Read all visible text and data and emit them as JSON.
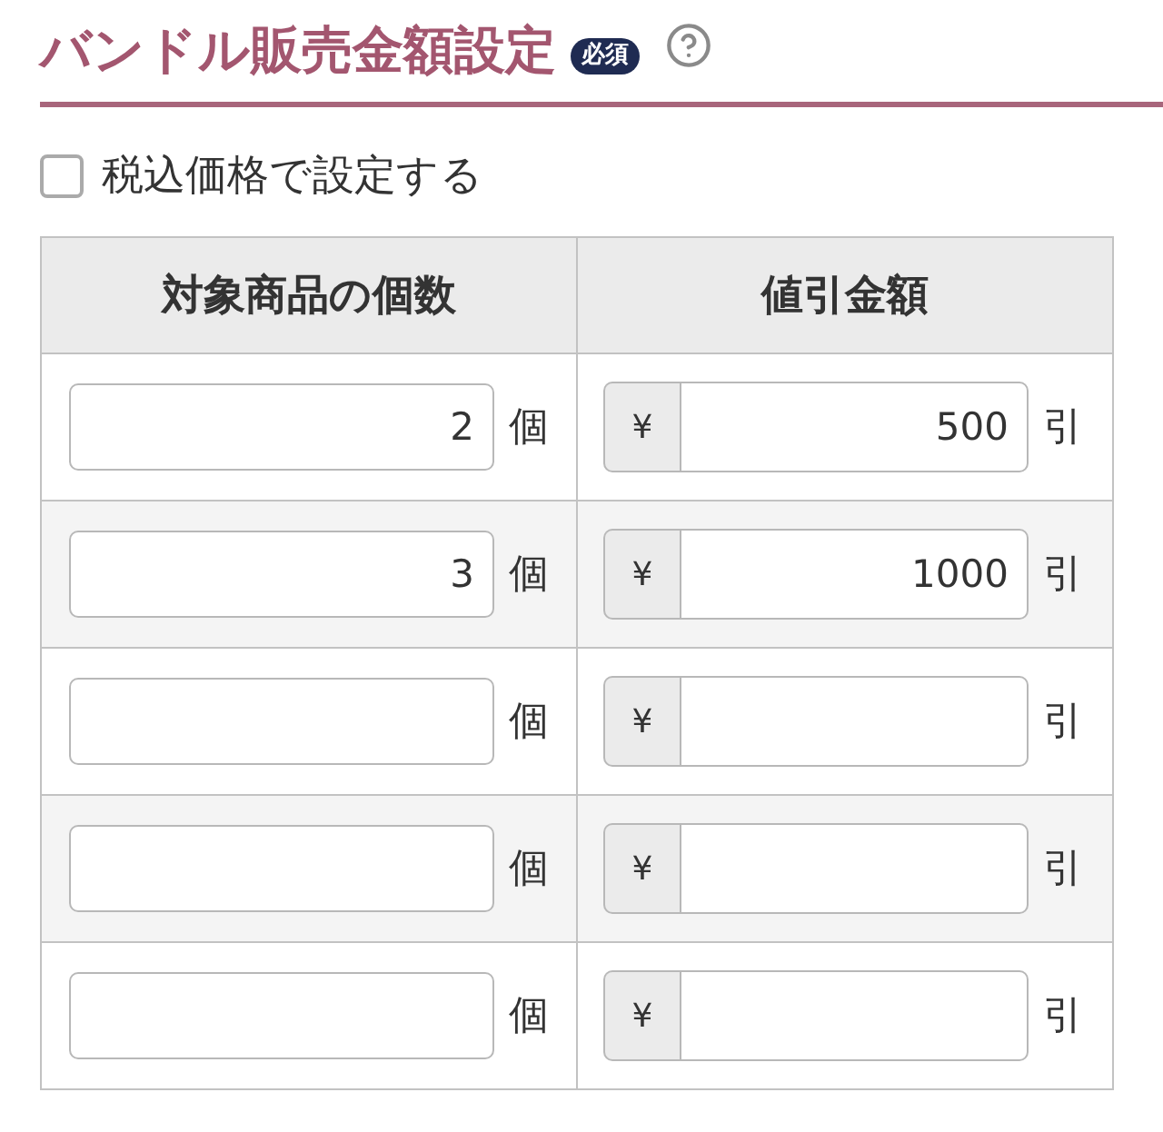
{
  "section": {
    "title": "バンドル販売金額設定",
    "required_badge": "必須"
  },
  "tax_option": {
    "label": "税込価格で設定する",
    "checked": false
  },
  "table": {
    "columns": [
      "対象商品の個数",
      "値引金額"
    ],
    "rows": [
      {
        "count": "2",
        "count_unit": "個",
        "currency": "¥",
        "discount": "500",
        "discount_suffix": "引"
      },
      {
        "count": "3",
        "count_unit": "個",
        "currency": "¥",
        "discount": "1000",
        "discount_suffix": "引"
      },
      {
        "count_unit": "個",
        "currency": "¥",
        "discount_suffix": "引"
      },
      {
        "count_unit": "個",
        "currency": "¥",
        "discount_suffix": "引"
      },
      {
        "count_unit": "個",
        "currency": "¥",
        "discount_suffix": "引"
      }
    ]
  }
}
